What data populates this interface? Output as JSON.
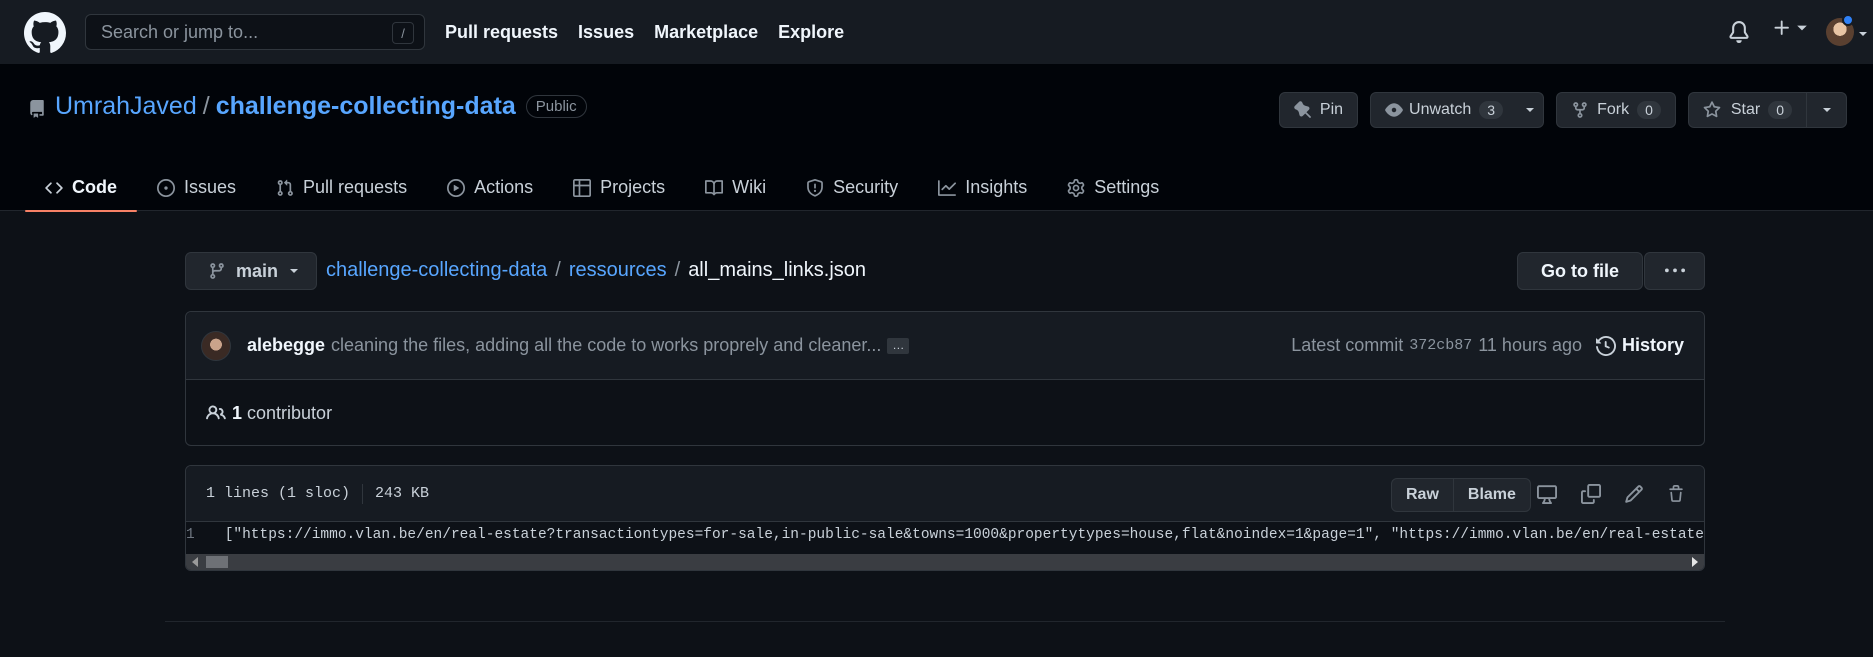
{
  "header": {
    "search_placeholder": "Search or jump to...",
    "search_shortcut": "/",
    "nav": [
      "Pull requests",
      "Issues",
      "Marketplace",
      "Explore"
    ],
    "icons": [
      "github-logo",
      "bell-icon",
      "plus-icon",
      "avatar"
    ]
  },
  "repo": {
    "owner": "UmrahJaved",
    "separator": "/",
    "name": "challenge-collecting-data",
    "visibility": "Public",
    "actions": {
      "pin": "Pin",
      "watch": "Unwatch",
      "watch_count": "3",
      "fork": "Fork",
      "fork_count": "0",
      "star": "Star",
      "star_count": "0"
    },
    "tabs": [
      {
        "label": "Code",
        "icon": "code-icon",
        "active": true
      },
      {
        "label": "Issues",
        "icon": "issue-icon"
      },
      {
        "label": "Pull requests",
        "icon": "pull-request-icon"
      },
      {
        "label": "Actions",
        "icon": "play-icon"
      },
      {
        "label": "Projects",
        "icon": "table-icon"
      },
      {
        "label": "Wiki",
        "icon": "book-icon"
      },
      {
        "label": "Security",
        "icon": "shield-icon"
      },
      {
        "label": "Insights",
        "icon": "graph-icon"
      },
      {
        "label": "Settings",
        "icon": "gear-icon"
      }
    ]
  },
  "file_nav": {
    "branch": "main",
    "crumbs": [
      "challenge-collecting-data",
      "ressources"
    ],
    "sep": "/",
    "file": "all_mains_links.json",
    "goto_file": "Go to file"
  },
  "commit": {
    "author": "alebegge",
    "message": "cleaning the files, adding all the code to works proprely and cleaner...",
    "ellipsis": "…",
    "latest_label": "Latest commit",
    "sha": "372cb87",
    "time": "11 hours ago",
    "history": "History",
    "contributors_count": "1",
    "contributors_label": "contributor"
  },
  "file": {
    "lines_info": "1 lines (1 sloc)",
    "size": "243 KB",
    "raw": "Raw",
    "blame": "Blame",
    "line_number": "1",
    "line_text": "[\"https://immo.vlan.be/en/real-estate?transactiontypes=for-sale,in-public-sale&towns=1000&propertytypes=house,flat&noindex=1&page=1\", \"https://immo.vlan.be/en/real-estate?tran"
  },
  "colors": {
    "bg": "#0d1117",
    "header_bg": "#161b22",
    "link": "#58a6ff",
    "active_tab_underline": "#f78166",
    "notification_dot": "#2f81f7"
  }
}
